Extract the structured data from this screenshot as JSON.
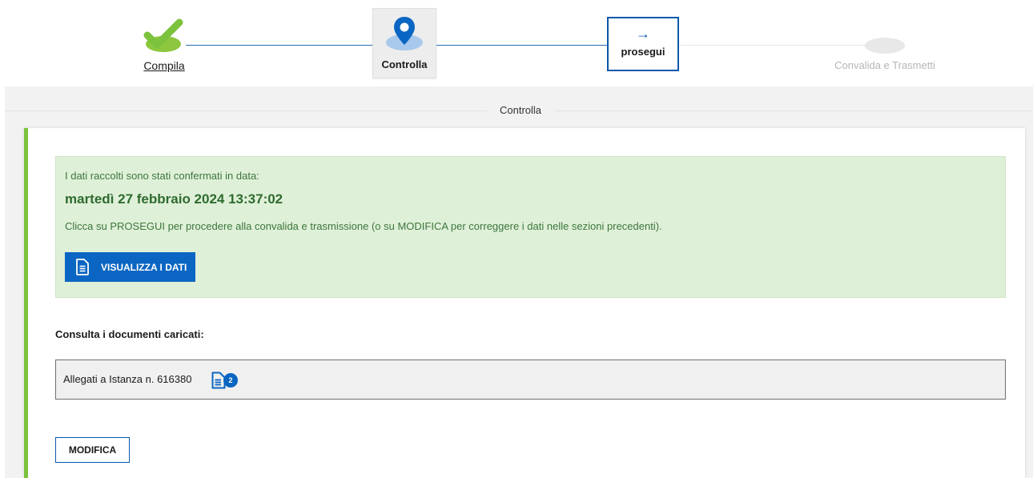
{
  "stepper": {
    "steps": [
      {
        "label": "Compila",
        "state": "completed"
      },
      {
        "label": "Controlla",
        "state": "current"
      },
      {
        "label": "prosegui",
        "arrow": "→",
        "state": "next-action"
      },
      {
        "label": "Convalida e Trasmetti",
        "state": "pending"
      }
    ]
  },
  "section": {
    "title": "Controlla"
  },
  "alert": {
    "intro": "I dati raccolti sono stati confermati in data:",
    "date": "martedì 27 febbraio 2024 13:37:02",
    "description": "Clicca su PROSEGUI per procedere alla convalida e trasmissione (o su MODIFICA per correggere i dati nelle sezioni precedenti).",
    "view_button": "VISUALIZZA I DATI"
  },
  "documents": {
    "label": "Consulta i documenti caricati:",
    "attachment_text": "Allegati a Istanza n. 616380",
    "attachment_count": "2"
  },
  "actions": {
    "modify_button": "MODIFICA"
  },
  "colors": {
    "primary": "#0a66c2",
    "success_bg": "#dff0d8",
    "success_text": "#3c763d",
    "accent_green": "#7cc23d",
    "check_green": "#8dc63f"
  },
  "icons": {
    "completed": "check-icon",
    "current": "location-pin-icon",
    "next": "arrow-right-icon",
    "document": "document-icon"
  }
}
